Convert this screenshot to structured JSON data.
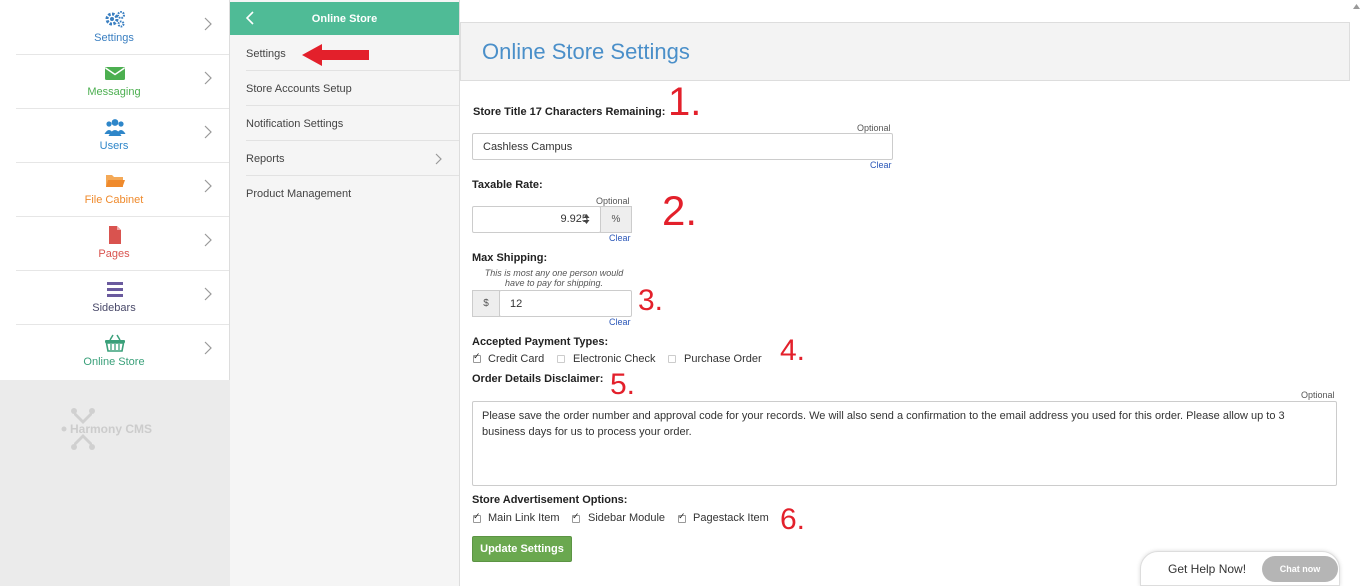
{
  "colors": {
    "accent_green": "#4fbb96",
    "title_blue": "#4a8fc9",
    "annotation_red": "#e3202b",
    "button_green": "#6aa84f"
  },
  "sidebar": {
    "items": [
      {
        "label": "Settings",
        "icon": "gears-icon",
        "color": "#3a7fc1"
      },
      {
        "label": "Messaging",
        "icon": "envelope-icon",
        "color": "#4caf50"
      },
      {
        "label": "Users",
        "icon": "users-icon",
        "color": "#2e86c9"
      },
      {
        "label": "File Cabinet",
        "icon": "folder-icon",
        "color": "#ef8a2c"
      },
      {
        "label": "Pages",
        "icon": "page-icon",
        "color": "#d9534f"
      },
      {
        "label": "Sidebars",
        "icon": "bars-icon",
        "color": "#6a5a9e"
      },
      {
        "label": "Online Store",
        "icon": "basket-icon",
        "color": "#3aa07a"
      }
    ],
    "logo_text": "Harmony CMS"
  },
  "subnav": {
    "title": "Online Store",
    "items": [
      {
        "label": "Settings"
      },
      {
        "label": "Store Accounts Setup"
      },
      {
        "label": "Notification Settings"
      },
      {
        "label": "Reports"
      },
      {
        "label": "Product Management"
      }
    ]
  },
  "main": {
    "title": "Online Store Settings",
    "store_title": {
      "label": "Store Title 17 Characters Remaining:",
      "optional": "Optional",
      "value": "Cashless Campus",
      "clear": "Clear",
      "annotation": "1."
    },
    "taxable_rate": {
      "label": "Taxable Rate:",
      "optional": "Optional",
      "value": "9.925",
      "suffix": "%",
      "clear": "Clear",
      "annotation": "2."
    },
    "max_shipping": {
      "label": "Max Shipping:",
      "note": "This is most any one person would have to pay for shipping.",
      "prefix": "$",
      "value": "12",
      "clear": "Clear",
      "annotation": "3."
    },
    "payment_types": {
      "label": "Accepted Payment Types:",
      "options": [
        {
          "label": "Credit Card",
          "checked": true
        },
        {
          "label": "Electronic Check",
          "checked": false
        },
        {
          "label": "Purchase Order",
          "checked": false
        }
      ],
      "annotation": "4."
    },
    "disclaimer": {
      "label": "Order Details Disclaimer:",
      "optional": "Optional",
      "value": "Please save the order number and approval code for your records. We will also send a confirmation to the email address you used for this order. Please allow up to 3 business days for us to process your order.",
      "annotation": "5."
    },
    "advertisement": {
      "label": "Store Advertisement Options:",
      "options": [
        {
          "label": "Main Link Item",
          "checked": true
        },
        {
          "label": "Sidebar Module",
          "checked": true
        },
        {
          "label": "Pagestack Item",
          "checked": true
        }
      ],
      "annotation": "6."
    },
    "update_button": "Update Settings"
  },
  "chat": {
    "help_text": "Get Help Now!",
    "button": "Chat now"
  }
}
